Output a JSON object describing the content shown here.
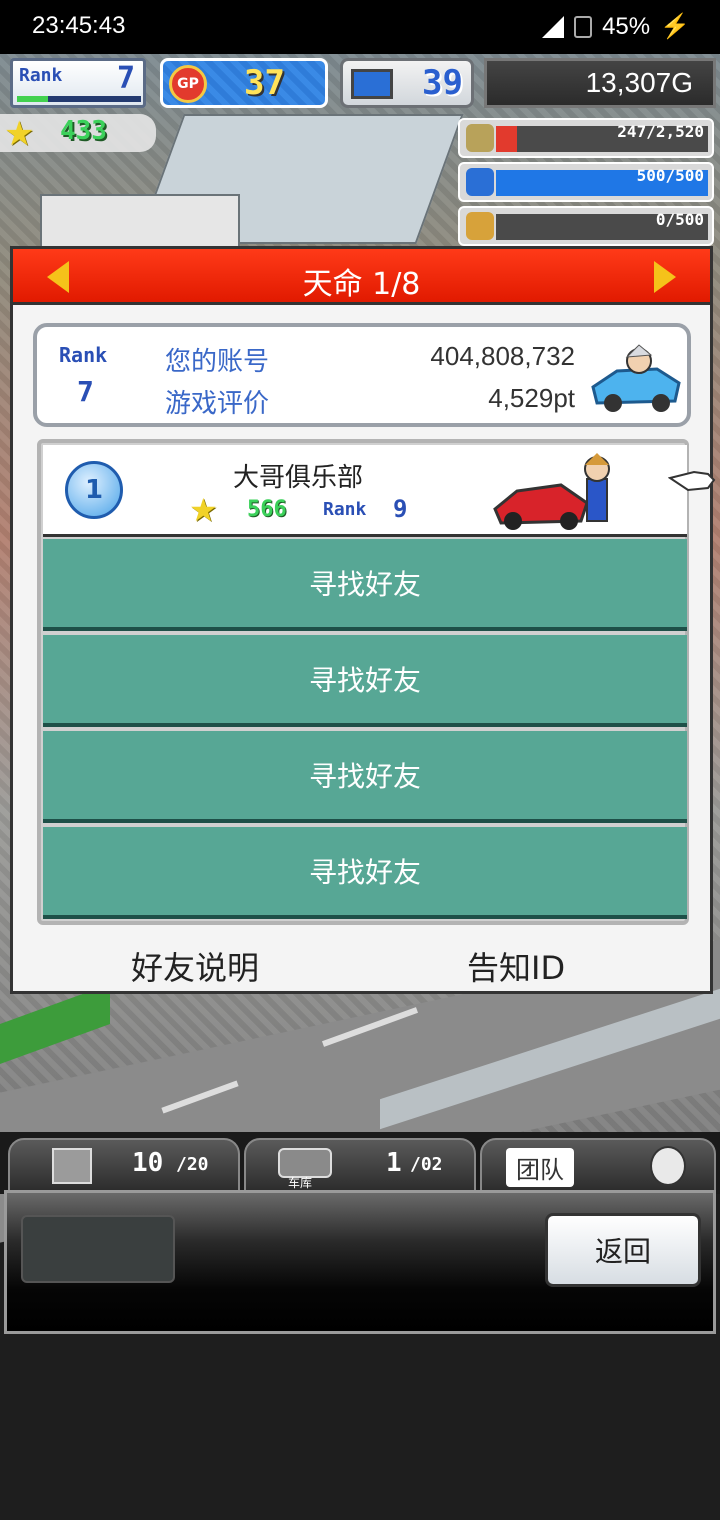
{
  "status_bar": {
    "time": "23:45:43",
    "battery": "45%"
  },
  "hud": {
    "rank_label": "Rank",
    "rank_value": "7",
    "rank_progress": 0.25,
    "gp_label": "GP",
    "gp_value": "37",
    "pc_value": "39",
    "money": "13,307G",
    "stars": "433",
    "gauges": [
      {
        "icon": "coin-stack-icon",
        "text": "247/2,520",
        "fill": 0.098,
        "color": "#e23a2d"
      },
      {
        "icon": "fuel-tank-icon",
        "text": "500/500",
        "fill": 1.0,
        "color": "#1f77e6"
      },
      {
        "icon": "wheat-icon",
        "text": "0/500",
        "fill": 0.0,
        "color": "#e8b431"
      }
    ]
  },
  "dialog": {
    "title": "天命 1/8",
    "account": {
      "rank_label": "Rank",
      "rank_value": "7",
      "account_label": "您的账号",
      "account_value": "404,808,732",
      "rating_label": "游戏评价",
      "rating_value": "4,529pt"
    },
    "friend": {
      "number": "1",
      "name": "大哥俱乐部",
      "stars": "566",
      "rank_label": "Rank",
      "rank_value": "9"
    },
    "find_slots": [
      "寻找好友",
      "寻找好友",
      "寻找好友",
      "寻找好友"
    ],
    "links": {
      "explain": "好友说明",
      "notify": "告知ID"
    }
  },
  "bottom": {
    "tab1_count": "10",
    "tab1_max": "/20",
    "tab2_label": "车库",
    "tab2_count": "1",
    "tab2_max": "/02",
    "tab3_label": "团队",
    "back_label": "返回"
  }
}
